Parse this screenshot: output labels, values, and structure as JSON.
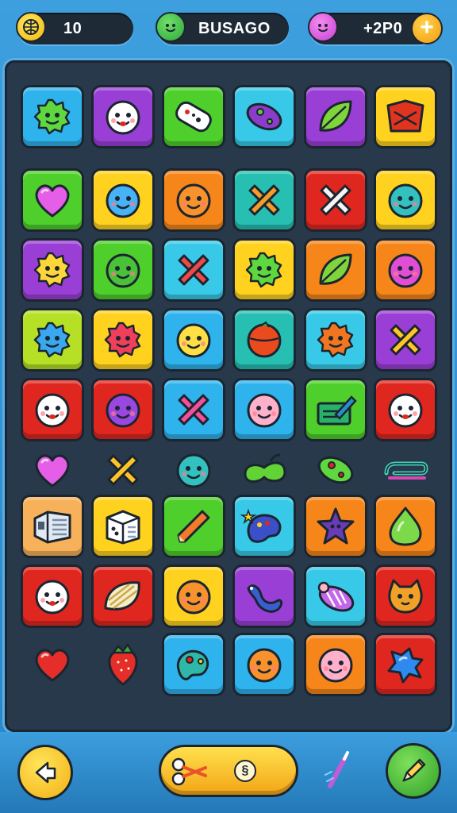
{
  "header": {
    "level_value": "10",
    "player_name": "BUSAGO",
    "score_value": "+2P0",
    "plus_label": "+"
  },
  "colors": {
    "blue": "#2fb3ec",
    "purple": "#9a3fd6",
    "green": "#4fcf2c",
    "cyan": "#38c9e8",
    "yellow": "#ffd21f",
    "orange": "#f7861a",
    "red": "#e0271f",
    "teal": "#27bfb2",
    "lime": "#b6e026",
    "peach": "#f7b15a"
  },
  "board": {
    "rows": [
      [
        {
          "kind": "tile",
          "color": "blue",
          "icon": "green-blob-icon"
        },
        {
          "kind": "tile",
          "color": "purple",
          "icon": "white-face-icon"
        },
        {
          "kind": "tile",
          "color": "green",
          "icon": "gamepad-icon"
        },
        {
          "kind": "tile",
          "color": "cyan",
          "icon": "purple-pod-icon"
        },
        {
          "kind": "tile",
          "color": "purple",
          "icon": "green-leaf-icon"
        },
        {
          "kind": "tile",
          "color": "yellow",
          "icon": "red-crate-icon"
        }
      ],
      [
        {
          "kind": "tile",
          "color": "green",
          "icon": "pink-heart-icon"
        },
        {
          "kind": "tile",
          "color": "yellow",
          "icon": "blue-face-icon"
        },
        {
          "kind": "tile",
          "color": "orange",
          "icon": "orange-face-icon"
        },
        {
          "kind": "tile",
          "color": "teal",
          "icon": "orange-cross-icon"
        },
        {
          "kind": "tile",
          "color": "red",
          "icon": "white-cross-icon"
        },
        {
          "kind": "tile",
          "color": "yellow",
          "icon": "teal-face-icon"
        }
      ],
      [
        {
          "kind": "tile",
          "color": "purple",
          "icon": "yellow-sun-face-icon"
        },
        {
          "kind": "tile",
          "color": "green",
          "icon": "green-face-icon"
        },
        {
          "kind": "tile",
          "color": "cyan",
          "icon": "red-cross-icon"
        },
        {
          "kind": "tile",
          "color": "yellow",
          "icon": "green-blob-icon"
        },
        {
          "kind": "tile",
          "color": "orange",
          "icon": "green-leaf-icon"
        },
        {
          "kind": "tile",
          "color": "orange",
          "icon": "magenta-face-icon"
        }
      ],
      [
        {
          "kind": "tile",
          "color": "lime",
          "icon": "blue-blob-icon"
        },
        {
          "kind": "tile",
          "color": "yellow",
          "icon": "red-blob-icon"
        },
        {
          "kind": "tile",
          "color": "blue",
          "icon": "yellow-face-icon"
        },
        {
          "kind": "tile",
          "color": "teal",
          "icon": "red-ball-icon"
        },
        {
          "kind": "tile",
          "color": "cyan",
          "icon": "orange-spiky-icon"
        },
        {
          "kind": "tile",
          "color": "purple",
          "icon": "yellow-cross-icon"
        }
      ],
      [
        {
          "kind": "tile",
          "color": "red",
          "icon": "white-face-icon"
        },
        {
          "kind": "tile",
          "color": "red",
          "icon": "purple-face-icon"
        },
        {
          "kind": "tile",
          "color": "blue",
          "icon": "pink-cross-icon"
        },
        {
          "kind": "tile",
          "color": "blue",
          "icon": "pink-face-icon"
        },
        {
          "kind": "tile",
          "color": "green",
          "icon": "pencil-note-icon"
        },
        {
          "kind": "tile",
          "color": "red",
          "icon": "white-face-icon"
        }
      ],
      [
        {
          "kind": "loose",
          "color": "",
          "icon": "pink-heart-icon"
        },
        {
          "kind": "loose",
          "color": "",
          "icon": "yellow-cross-icon"
        },
        {
          "kind": "loose",
          "color": "",
          "icon": "teal-face-icon"
        },
        {
          "kind": "loose",
          "color": "",
          "icon": "green-bean-icon"
        },
        {
          "kind": "loose",
          "color": "",
          "icon": "green-pod-icon"
        },
        {
          "kind": "loose",
          "color": "",
          "icon": "teal-clip-icon"
        }
      ],
      [
        {
          "kind": "tile",
          "color": "peach",
          "icon": "machine-icon"
        },
        {
          "kind": "tile",
          "color": "yellow",
          "icon": "dice-box-icon"
        },
        {
          "kind": "tile",
          "color": "green",
          "icon": "orange-pencil-icon"
        },
        {
          "kind": "tile",
          "color": "cyan",
          "icon": "blue-palette-icon"
        },
        {
          "kind": "tile",
          "color": "orange",
          "icon": "purple-star-icon"
        },
        {
          "kind": "tile",
          "color": "orange",
          "icon": "green-drop-icon"
        }
      ],
      [
        {
          "kind": "tile",
          "color": "red",
          "icon": "white-face-icon"
        },
        {
          "kind": "tile",
          "color": "red",
          "icon": "shell-icon"
        },
        {
          "kind": "tile",
          "color": "yellow",
          "icon": "orange-face-icon"
        },
        {
          "kind": "tile",
          "color": "purple",
          "icon": "blue-worm-icon"
        },
        {
          "kind": "tile",
          "color": "cyan",
          "icon": "candy-icon"
        },
        {
          "kind": "tile",
          "color": "red",
          "icon": "orange-cat-icon"
        }
      ],
      [
        {
          "kind": "loose",
          "color": "",
          "icon": "red-heart-icon"
        },
        {
          "kind": "loose",
          "color": "",
          "icon": "strawberry-icon"
        },
        {
          "kind": "tile",
          "color": "blue",
          "icon": "teal-palette-icon"
        },
        {
          "kind": "tile",
          "color": "blue",
          "icon": "orange-face-icon"
        },
        {
          "kind": "tile",
          "color": "orange",
          "icon": "pink-face-icon"
        },
        {
          "kind": "tile",
          "color": "red",
          "icon": "blue-splat-icon"
        }
      ]
    ]
  },
  "footer": {
    "back_icon": "arrow-icon",
    "center_badge": "§",
    "wand_icon": "wand-icon",
    "pencil_icon": "pencil-icon"
  }
}
